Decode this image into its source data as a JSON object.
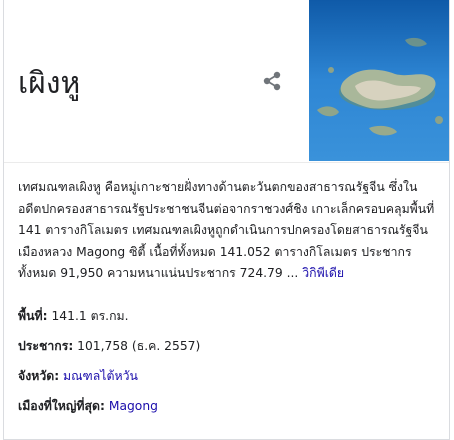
{
  "entity": {
    "title": "เผิงหู",
    "share_icon": "share-icon",
    "image_alt": "aerial-island-photo"
  },
  "description": {
    "text": "เทศมณฑลเผิงหู คือหมู่เกาะชายฝั่งทางด้านตะวันตกของสาธารณรัฐจีน ซึ่งในอดีตปกครองสาธารณรัฐประชาชนจีนต่อจากราชวงศ์ชิง เกาะเล็กครอบคลุมพื้นที่ 141 ตารางกิโลเมตร เทศมณฑลเผิงหูถูกดำเนินการปกครองโดยสาธารณรัฐจีน เมืองหลวง Magong ซิตี้ เนื้อที่ทั้งหมด 141.052 ตารางกิโลเมตร ประชากรทั้งหมด 91,950 ความหนาแน่นประชากร 724.79 ...",
    "source_link": "วิกิพีเดีย"
  },
  "facts": [
    {
      "label": "พื้นที่:",
      "value": "141.1 ตร.กม.",
      "link": false
    },
    {
      "label": "ประชากร:",
      "value": "101,758 (ธ.ค. 2557)",
      "link": false
    },
    {
      "label": "จังหวัด:",
      "value": "มณฑลไต้หวัน",
      "link": true
    },
    {
      "label": "เมืองที่ใหญ่ที่สุด:",
      "value": "Magong",
      "link": true
    }
  ],
  "colors": {
    "link": "#1a0dab",
    "text": "#202124",
    "icon": "#70757a",
    "sea": "#1f73c4"
  }
}
